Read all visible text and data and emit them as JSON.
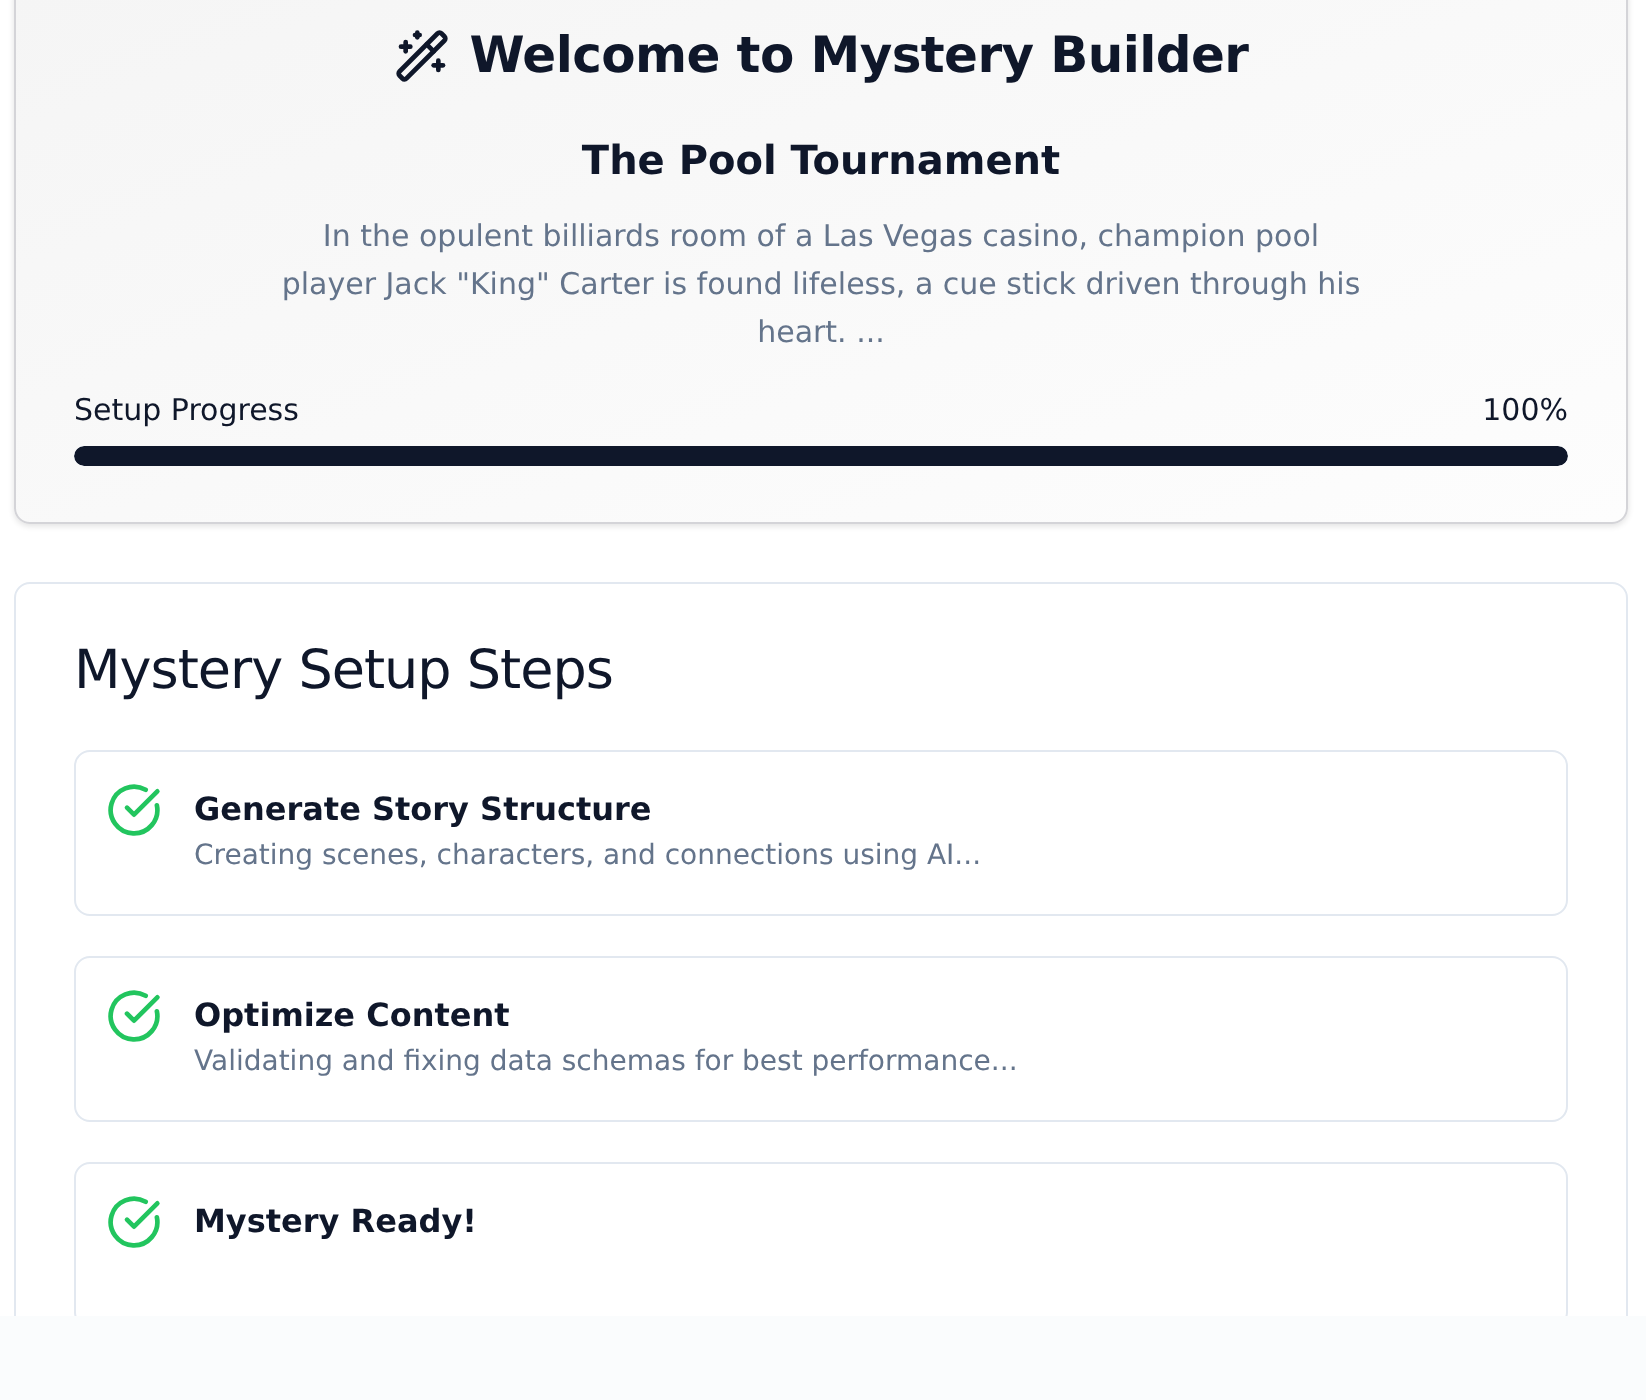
{
  "header": {
    "title": "Welcome to Mystery Builder",
    "mystery_title": "The Pool Tournament",
    "summary": "In the opulent billiards room of a Las Vegas casino, champion pool player Jack \"King\" Carter is found lifeless, a cue stick driven through his heart. ...",
    "progress": {
      "label": "Setup Progress",
      "reading": "100%",
      "level": 1
    }
  },
  "steps_panel": {
    "title": "Mystery Setup Steps",
    "steps": [
      {
        "title": "Generate Story Structure",
        "description": "Creating scenes, characters, and connections using AI...",
        "done": true
      },
      {
        "title": "Optimize Content",
        "description": "Validating and fixing data schemas for best performance...",
        "done": true
      },
      {
        "title": "Mystery Ready!",
        "done": true
      }
    ]
  }
}
